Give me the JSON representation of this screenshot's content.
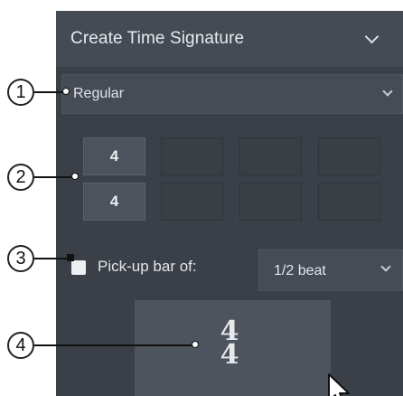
{
  "panel": {
    "title": "Create Time Signature"
  },
  "type_select": {
    "value": "Regular"
  },
  "grid": {
    "numerator": "4",
    "denominator": "4"
  },
  "pickup": {
    "label": "Pick-up bar of:",
    "checked": false,
    "beat_value": "1/2 beat"
  },
  "create_button": {
    "glyph_top": "4",
    "glyph_bottom": "4"
  },
  "callouts": [
    "1",
    "2",
    "3",
    "4"
  ],
  "icons": {
    "header_chevron": "chevron-down-icon",
    "select_chevron": "chevron-down-icon",
    "cursor": "mouse-pointer-icon"
  },
  "colors": {
    "panel_bg": "#3b4048",
    "header_bg": "#454b54",
    "text": "#e8eaed"
  }
}
